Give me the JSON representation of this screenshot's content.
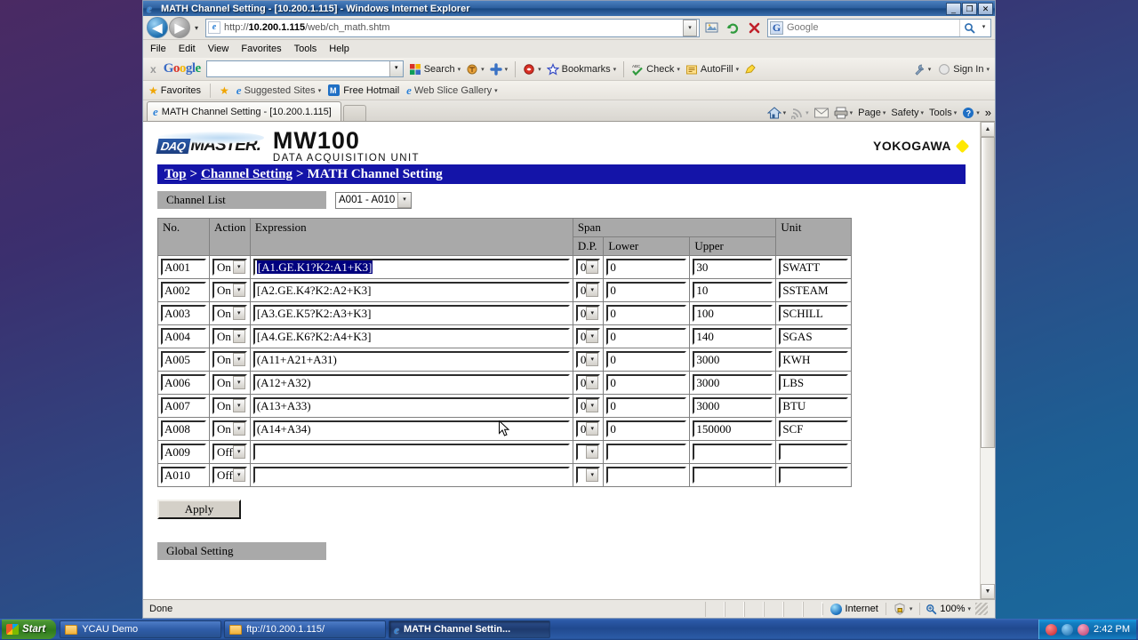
{
  "window": {
    "title": "MATH Channel Setting - [10.200.1.115] - Windows Internet Explorer",
    "minimize": "_",
    "restore": "❐",
    "close": "✕"
  },
  "address_bar": {
    "back_icon": "◀",
    "forward_icon": "▶",
    "history_caret": "▾",
    "url_prefix": "http://",
    "url_host": "10.200.1.115",
    "url_path": "/web/ch_math.shtm",
    "url_full": "http://10.200.1.115/web/ch_math.shtm",
    "dropdown_caret": "▾",
    "buttons": [
      "compatibility-view",
      "refresh",
      "stop"
    ],
    "refresh_icon": "↻",
    "stop_icon": "✕",
    "search_engine": "G",
    "search_placeholder": "Google",
    "search_value": "",
    "search_go_icon": "⚲",
    "search_caret": "▾"
  },
  "menu": {
    "items": [
      "File",
      "Edit",
      "View",
      "Favorites",
      "Tools",
      "Help"
    ]
  },
  "google_toolbar": {
    "close_label": "x",
    "brand": [
      {
        "ch": "G",
        "cls": "b1"
      },
      {
        "ch": "o",
        "cls": "r"
      },
      {
        "ch": "o",
        "cls": "y"
      },
      {
        "ch": "g",
        "cls": "b2"
      },
      {
        "ch": "l",
        "cls": "b1"
      },
      {
        "ch": "e",
        "cls": "g"
      }
    ],
    "search_value": "",
    "items": [
      {
        "label": "Search",
        "icon": "google-search-icon",
        "caret": "▾"
      },
      {
        "label": "",
        "icon": "translate-icon",
        "caret": "▾"
      },
      {
        "label": "",
        "icon": "plus-icon",
        "caret": "▾"
      },
      {
        "label": "",
        "icon": "bookmark-red-icon",
        "caret": "▾"
      },
      {
        "label": "Bookmarks",
        "icon": "star-blue-icon",
        "caret": "▾"
      },
      {
        "label": "Check",
        "icon": "spellcheck-icon",
        "caret": "▾"
      },
      {
        "label": "AutoFill",
        "icon": "autofill-icon",
        "caret": "▾"
      },
      {
        "label": "",
        "icon": "highlighter-icon",
        "caret": ""
      }
    ],
    "right_items": [
      {
        "label": "",
        "icon": "wrench-icon",
        "caret": "▾"
      },
      {
        "label": "Sign In",
        "icon": "signin-icon",
        "caret": "▾"
      }
    ]
  },
  "favorites_bar": {
    "favorites_label": "Favorites",
    "items": [
      {
        "label": "Suggested Sites",
        "icon": "ie-icon",
        "caret": "▾"
      },
      {
        "label": "Free Hotmail",
        "icon": "hotmail-icon",
        "caret": ""
      },
      {
        "label": "Web Slice Gallery",
        "icon": "ie-icon",
        "caret": "▾"
      }
    ]
  },
  "tabs": {
    "items": [
      {
        "label": "MATH Channel Setting - [10.200.1.115]",
        "active": true
      }
    ],
    "new_tab_tooltip": "New Tab",
    "commands": [
      {
        "label": "",
        "icon": "home-icon",
        "caret": "▾"
      },
      {
        "label": "",
        "icon": "feeds-icon",
        "caret": "▾"
      },
      {
        "label": "",
        "icon": "mail-icon",
        "caret": ""
      },
      {
        "label": "",
        "icon": "print-icon",
        "caret": "▾"
      },
      {
        "label": "Page",
        "icon": "",
        "caret": "▾"
      },
      {
        "label": "Safety",
        "icon": "",
        "caret": "▾"
      },
      {
        "label": "Tools",
        "icon": "",
        "caret": "▾"
      },
      {
        "label": "",
        "icon": "help-icon",
        "caret": "▾"
      }
    ],
    "overflow": "»"
  },
  "brand": {
    "daq_badge": "DAQ",
    "daq_master": "MASTER.",
    "product": "MW100",
    "product_sub": "DATA ACQUISITION UNIT",
    "company": "YOKOGAWA"
  },
  "breadcrumb": {
    "top": "Top",
    "sep": ">",
    "channel_setting": "Channel Setting",
    "current": "MATH Channel Setting"
  },
  "channel_list": {
    "label": "Channel List",
    "selected_range": "A001 - A010",
    "caret": "▾"
  },
  "table": {
    "headers": {
      "no": "No.",
      "action": "Action",
      "expression": "Expression",
      "span": "Span",
      "dp": "D.P.",
      "lower": "Lower",
      "upper": "Upper",
      "unit": "Unit"
    },
    "rows": [
      {
        "no": "A001",
        "action": "On",
        "expression": "[A1.GE.K1?K2:A1+K3]",
        "selected": true,
        "dp": "0",
        "lower": "0",
        "upper": "30",
        "unit": "SWATT"
      },
      {
        "no": "A002",
        "action": "On",
        "expression": "[A2.GE.K4?K2:A2+K3]",
        "selected": false,
        "dp": "0",
        "lower": "0",
        "upper": "10",
        "unit": "SSTEAM"
      },
      {
        "no": "A003",
        "action": "On",
        "expression": "[A3.GE.K5?K2:A3+K3]",
        "selected": false,
        "dp": "0",
        "lower": "0",
        "upper": "100",
        "unit": "SCHILL"
      },
      {
        "no": "A004",
        "action": "On",
        "expression": "[A4.GE.K6?K2:A4+K3]",
        "selected": false,
        "dp": "0",
        "lower": "0",
        "upper": "140",
        "unit": "SGAS"
      },
      {
        "no": "A005",
        "action": "On",
        "expression": "(A11+A21+A31)",
        "selected": false,
        "dp": "0",
        "lower": "0",
        "upper": "3000",
        "unit": "KWH"
      },
      {
        "no": "A006",
        "action": "On",
        "expression": "(A12+A32)",
        "selected": false,
        "dp": "0",
        "lower": "0",
        "upper": "3000",
        "unit": "LBS"
      },
      {
        "no": "A007",
        "action": "On",
        "expression": "(A13+A33)",
        "selected": false,
        "dp": "0",
        "lower": "0",
        "upper": "3000",
        "unit": "BTU"
      },
      {
        "no": "A008",
        "action": "On",
        "expression": "(A14+A34)",
        "selected": false,
        "dp": "0",
        "lower": "0",
        "upper": "150000",
        "unit": "SCF"
      },
      {
        "no": "A009",
        "action": "Off",
        "expression": "",
        "selected": false,
        "dp": "",
        "lower": "",
        "upper": "",
        "unit": ""
      },
      {
        "no": "A010",
        "action": "Off",
        "expression": "",
        "selected": false,
        "dp": "",
        "lower": "",
        "upper": "",
        "unit": ""
      }
    ],
    "dropdown_caret": "▾"
  },
  "buttons": {
    "apply": "Apply",
    "global_setting": "Global Setting"
  },
  "status_bar": {
    "text": "Done",
    "zone": "Internet",
    "zone_icon": "globe-icon",
    "protect_icon": "protected-mode-icon",
    "protect_caret": "▾",
    "zoom": "100%",
    "zoom_icon": "magnifier-icon",
    "zoom_caret": "▾"
  },
  "taskbar": {
    "start": "Start",
    "items": [
      {
        "label": "YCAU Demo",
        "icon": "folder-icon",
        "active": false
      },
      {
        "label": "ftp://10.200.1.115/",
        "icon": "folder-icon",
        "active": false
      },
      {
        "label": "MATH Channel Settin...",
        "icon": "ie-icon",
        "active": true
      }
    ],
    "tray_icons": [
      "shield-icon",
      "ie-icon",
      "network-icon"
    ],
    "clock": "2:42 PM"
  },
  "colors": {
    "breadcrumb_bg": "#1414a8",
    "header_bg": "#a9a9a9",
    "selection_bg": "#00007e",
    "titlebar_blue": "#2a5d9c",
    "yokogawa_yellow": "#ffe800"
  }
}
